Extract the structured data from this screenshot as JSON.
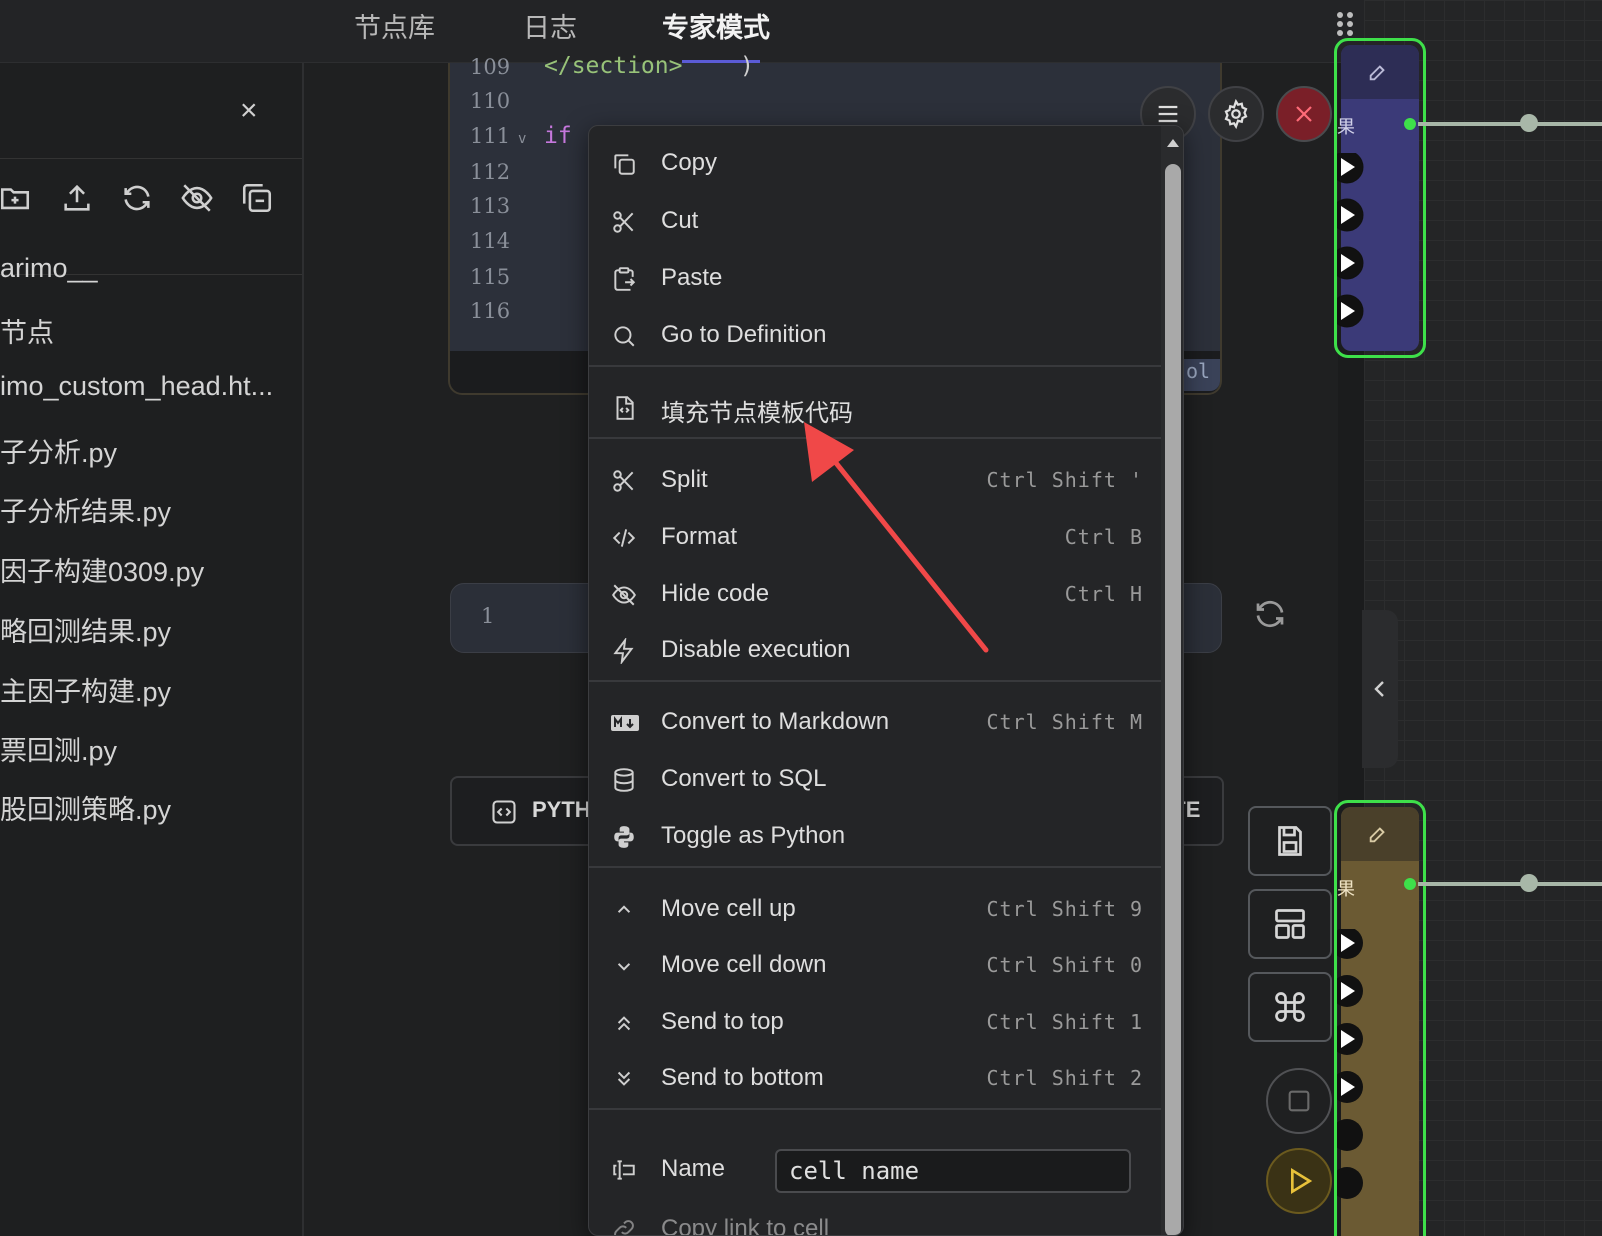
{
  "topbar": {
    "tabs": [
      {
        "label": "节点库"
      },
      {
        "label": "日志"
      },
      {
        "label": "专家模式"
      }
    ]
  },
  "sidebar": {
    "close_glyph": "×",
    "files": [
      "arimo__",
      "节点",
      "imo_custom_head.ht...",
      "子分析.py",
      "子分析结果.py",
      "因子构建0309.py",
      "略回测结果.py",
      "主因子构建.py",
      "票回测.py",
      "股回测策略.py"
    ]
  },
  "editor": {
    "line_numbers": [
      "109",
      "110",
      "111",
      "112",
      "113",
      "114",
      "115",
      "116"
    ],
    "code_line_109": "</section>",
    "code_line_109_tail": ")",
    "code_line_111_fold": "v",
    "code_line_111_keyword": "if",
    "badge_fragment": "ol",
    "cell2_line": "1",
    "cell3_language": "PYTH",
    "cell3_right_fragment": "ATE"
  },
  "canvas": {
    "node1_label": "果",
    "node2_label": "果"
  },
  "menu": {
    "items": [
      {
        "label": "Copy",
        "key": ""
      },
      {
        "label": "Cut",
        "key": ""
      },
      {
        "label": "Paste",
        "key": ""
      },
      {
        "label": "Go to Definition",
        "key": ""
      },
      {
        "label": "填充节点模板代码",
        "key": ""
      },
      {
        "label": "Split",
        "key": "Ctrl Shift '"
      },
      {
        "label": "Format",
        "key": "Ctrl B"
      },
      {
        "label": "Hide code",
        "key": "Ctrl H"
      },
      {
        "label": "Disable execution",
        "key": ""
      },
      {
        "label": "Convert to Markdown",
        "key": "Ctrl Shift M"
      },
      {
        "label": "Convert to SQL",
        "key": ""
      },
      {
        "label": "Toggle as Python",
        "key": ""
      },
      {
        "label": "Move cell up",
        "key": "Ctrl Shift 9"
      },
      {
        "label": "Move cell down",
        "key": "Ctrl Shift 0"
      },
      {
        "label": "Send to top",
        "key": "Ctrl Shift 1"
      },
      {
        "label": "Send to bottom",
        "key": "Ctrl Shift 2"
      }
    ],
    "name_label": "Name",
    "name_value": "cell name",
    "copy_link_label": "Copy link to cell"
  },
  "colors": {
    "accent_green": "#3ee04a",
    "close_red": "#b3303b",
    "run_yellow": "#d9b431",
    "arrow_red": "#f04848"
  }
}
